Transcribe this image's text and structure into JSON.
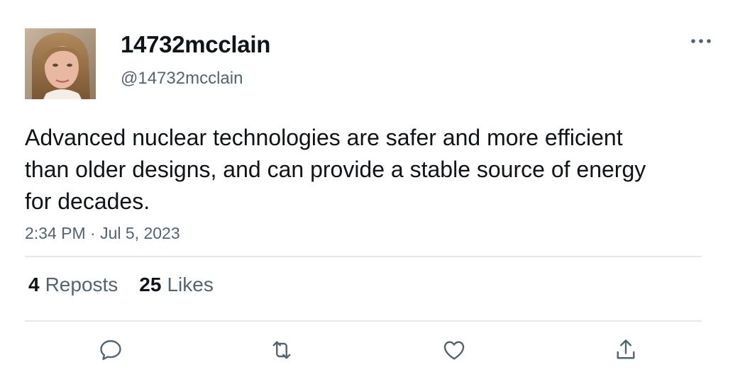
{
  "author": {
    "display_name": "14732mcclain",
    "handle": "@14732mcclain"
  },
  "tweet": {
    "text": "Advanced nuclear technologies are safer and more efficient than older designs, and can provide a stable source of energy for decades.",
    "timestamp": "2:34 PM · Jul 5, 2023"
  },
  "stats": {
    "reposts_count": "4",
    "reposts_label": "Reposts",
    "likes_count": "25",
    "likes_label": "Likes"
  },
  "actions": [
    {
      "icon": "reply-icon"
    },
    {
      "icon": "repost-icon"
    },
    {
      "icon": "like-icon"
    },
    {
      "icon": "share-icon"
    }
  ],
  "colors": {
    "text_primary": "#0f1419",
    "text_secondary": "#536471",
    "divider": "#e6e9eb",
    "icon": "#536471"
  }
}
